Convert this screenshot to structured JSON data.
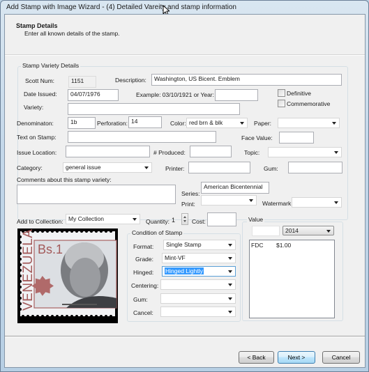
{
  "window": {
    "title": "Add Stamp with Image Wizard - (4) Detailed Vareity and stamp information"
  },
  "header": {
    "title": "Stamp Details",
    "subtitle": "Enter all known details of the stamp."
  },
  "variety_group": {
    "label": "Stamp Variety Details",
    "scott_num": {
      "label": "Scott Num:",
      "value": "1151"
    },
    "description": {
      "label": "Description:",
      "value": "Washington, US Bicent. Emblem"
    },
    "date_issued": {
      "label": "Date Issued:",
      "value": "04/07/1976"
    },
    "example": {
      "label": "Example: 03/10/1921 or Year:",
      "value": ""
    },
    "definitive": {
      "label": "Definitive",
      "checked": false
    },
    "commemorative": {
      "label": "Commemorative",
      "checked": false
    },
    "variety": {
      "label": "Variety:",
      "value": ""
    },
    "denomination": {
      "label": "Denominaton:",
      "value": "1b"
    },
    "perforation": {
      "label": "Perforation:",
      "value": "14"
    },
    "color": {
      "label": "Color:",
      "value": "red brn & blk"
    },
    "paper": {
      "label": "Paper:",
      "value": ""
    },
    "text_on_stamp": {
      "label": "Text on Stamp:",
      "value": ""
    },
    "face_value": {
      "label": "Face Value:",
      "value": ""
    },
    "issue_location": {
      "label": "Issue Location:",
      "value": ""
    },
    "produced": {
      "label": "# Produced:",
      "value": ""
    },
    "topic": {
      "label": "Topic:",
      "value": ""
    },
    "category": {
      "label": "Category:",
      "value": "general issue"
    },
    "printer": {
      "label": "Printer:",
      "value": ""
    },
    "gum": {
      "label": "Gum:",
      "value": ""
    },
    "comments": {
      "label": "Comments about this stamp variety:",
      "value": ""
    },
    "series": {
      "label": "Series:",
      "value": "American Bicentennial"
    },
    "print": {
      "label": "Print:",
      "value": ""
    },
    "watermark": {
      "label": "Watermark:",
      "value": ""
    }
  },
  "collection": {
    "add_label": "Add to Collection:",
    "collection_value": "My Collection",
    "quantity_label": "Quantity:",
    "quantity_value": "1",
    "cost_label": "Cost:",
    "cost_value": ""
  },
  "stamp_image": {
    "country": "VENEZUELA",
    "denomination": "Bs.1"
  },
  "condition": {
    "label": "Condition of Stamp",
    "format": {
      "label": "Format:",
      "value": "Single Stamp"
    },
    "grade": {
      "label": "Grade:",
      "value": "Mint-VF"
    },
    "hinged": {
      "label": "Hinged:",
      "value": "Hinged Lightly"
    },
    "centering": {
      "label": "Centering:",
      "value": ""
    },
    "gum": {
      "label": "Gum:",
      "value": ""
    },
    "cancel": {
      "label": "Cancel:",
      "value": ""
    }
  },
  "value_group": {
    "label": "Value",
    "amount_value": "",
    "year_value": "2014",
    "entries": [
      {
        "type": "FDC",
        "price": "$1.00"
      }
    ]
  },
  "footer": {
    "back_label": "< Back",
    "next_label": "Next >",
    "cancel_label": "Cancel"
  }
}
